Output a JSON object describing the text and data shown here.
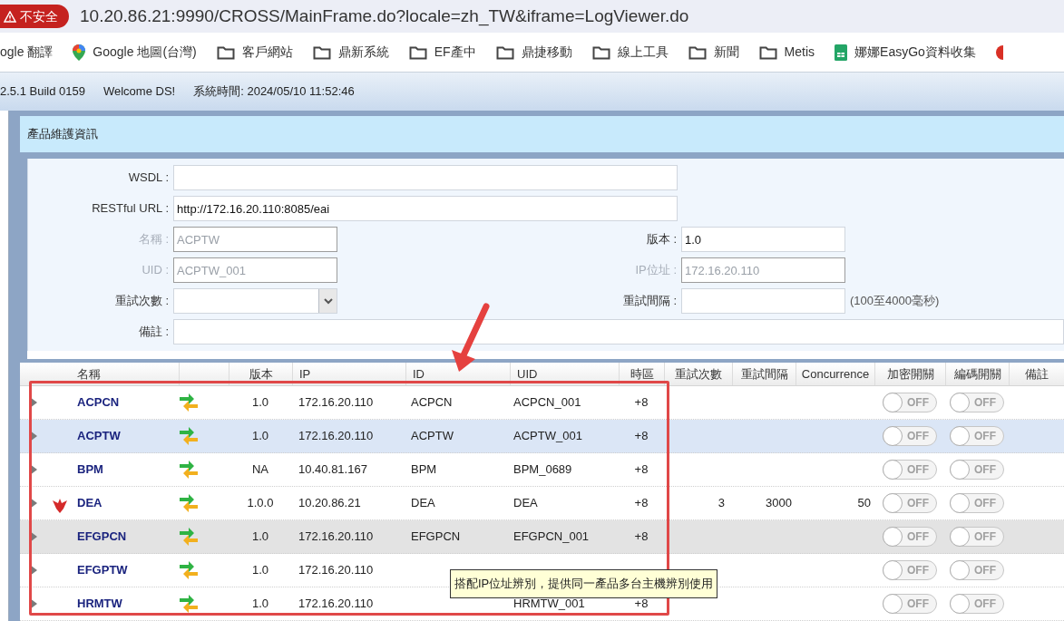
{
  "browser": {
    "security_label": "不安全",
    "url": "10.20.86.21:9990/CROSS/MainFrame.do?locale=zh_TW&iframe=LogViewer.do"
  },
  "bookmarks": [
    {
      "kind": "plain",
      "label": "ogle 翻譯"
    },
    {
      "kind": "maps",
      "label": "Google 地圖(台灣)"
    },
    {
      "kind": "folder",
      "label": "客戶網站"
    },
    {
      "kind": "folder",
      "label": "鼎新系統"
    },
    {
      "kind": "folder",
      "label": "EF產中"
    },
    {
      "kind": "folder",
      "label": "鼎捷移動"
    },
    {
      "kind": "folder",
      "label": "線上工具"
    },
    {
      "kind": "folder",
      "label": "新聞"
    },
    {
      "kind": "folder",
      "label": "Metis"
    },
    {
      "kind": "sheet",
      "label": "娜娜EasyGo資料收集"
    },
    {
      "kind": "clipped"
    }
  ],
  "header": {
    "version": "2.5.1 Build 0159",
    "welcome": "Welcome DS!",
    "time": "系統時間: 2024/05/10 11:52:46"
  },
  "panel": {
    "title": "產品維護資訊"
  },
  "form": {
    "wsdl": {
      "label": "WSDL :",
      "disabled": false
    },
    "restful_url": {
      "label": "RESTful URL :",
      "value": "http://172.16.20.110:8085/eai",
      "disabled": false
    },
    "name": {
      "label": "名稱 :",
      "value": "ACPTW",
      "disabled": true
    },
    "version": {
      "label": "版本 :",
      "value": "1.0",
      "disabled": false
    },
    "uid": {
      "label": "UID :",
      "value": "ACPTW_001",
      "disabled": true
    },
    "ip": {
      "label": "IP位址 :",
      "value": "172.16.20.110",
      "disabled": true
    },
    "retry_count": {
      "label": "重試次數 :",
      "disabled": false
    },
    "retry_interval": {
      "label": "重試間隔 :",
      "disabled": false,
      "hint": "(100至4000毫秒)"
    },
    "note": {
      "label": "備註 :",
      "disabled": false
    }
  },
  "table": {
    "columns": [
      "名稱",
      "版本",
      "IP",
      "ID",
      "UID",
      "時區",
      "重試次數",
      "重試間隔",
      "Concurrence",
      "加密開關",
      "編碼開關",
      "備註"
    ],
    "rows": [
      {
        "name": "ACPCN",
        "version": "1.0",
        "ip": "172.16.20.110",
        "id": "ACPCN",
        "uid": "ACPCN_001",
        "timezone": "+8",
        "badge": false,
        "selected": false,
        "hovered": false,
        "encrypt": {
          "label": "OFF",
          "on": false
        },
        "encoding": {
          "label": "OFF",
          "on": false
        }
      },
      {
        "name": "ACPTW",
        "version": "1.0",
        "ip": "172.16.20.110",
        "id": "ACPTW",
        "uid": "ACPTW_001",
        "timezone": "+8",
        "badge": false,
        "selected": true,
        "hovered": false,
        "encrypt": {
          "label": "OFF",
          "on": false
        },
        "encoding": {
          "label": "OFF",
          "on": false
        }
      },
      {
        "name": "BPM",
        "version": "NA",
        "ip": "10.40.81.167",
        "id": "BPM",
        "uid": "BPM_0689",
        "timezone": "+8",
        "badge": false,
        "selected": false,
        "hovered": false,
        "encrypt": {
          "label": "OFF",
          "on": false
        },
        "encoding": {
          "label": "OFF",
          "on": false
        }
      },
      {
        "name": "DEA",
        "version": "1.0.0",
        "ip": "10.20.86.21",
        "id": "DEA",
        "uid": "DEA",
        "timezone": "+8",
        "retry_count": "3",
        "retry_interval": "3000",
        "concurrence": "50",
        "badge": true,
        "selected": false,
        "hovered": false,
        "encrypt": {
          "label": "OFF",
          "on": false
        },
        "encoding": {
          "label": "OFF",
          "on": false
        }
      },
      {
        "name": "EFGPCN",
        "version": "1.0",
        "ip": "172.16.20.110",
        "id": "EFGPCN",
        "uid": "EFGPCN_001",
        "timezone": "+8",
        "badge": false,
        "selected": false,
        "hovered": true,
        "encrypt": {
          "label": "OFF",
          "on": false
        },
        "encoding": {
          "label": "OFF",
          "on": false
        }
      },
      {
        "name": "EFGPTW",
        "version": "1.0",
        "ip": "172.16.20.110",
        "badge": false,
        "selected": false,
        "hovered": false,
        "encrypt": {
          "label": "OFF",
          "on": false
        },
        "encoding": {
          "label": "OFF",
          "on": false
        }
      },
      {
        "name": "HRMTW",
        "version": "1.0",
        "ip": "172.16.20.110",
        "uid": "HRMTW_001",
        "timezone": "+8",
        "badge": false,
        "selected": false,
        "hovered": false,
        "encrypt": {
          "label": "OFF",
          "on": false
        },
        "encoding": {
          "label": "OFF",
          "on": false
        }
      }
    ],
    "tooltip": "搭配IP位址辨別，提供同一產品多台主機辨別使用"
  }
}
